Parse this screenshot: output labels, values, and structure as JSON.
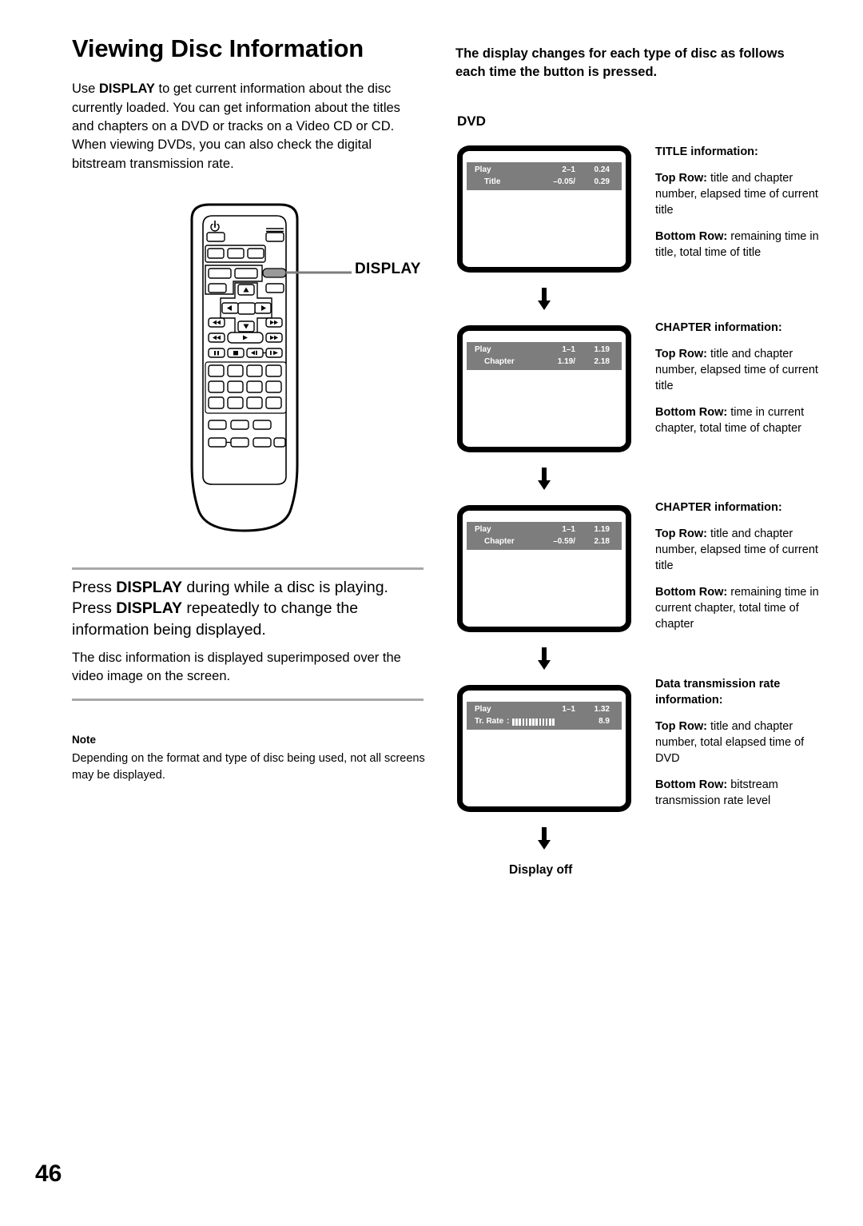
{
  "page": {
    "number": "46"
  },
  "left": {
    "title": "Viewing Disc Information",
    "intro_pre": "Use ",
    "intro_bold": "DISPLAY",
    "intro_post": " to get current information about the disc currently loaded. You can get information about the titles and chapters on a DVD or tracks on a Video CD or CD. When viewing DVDs, you can also check the digital bitstream transmission rate.",
    "remote_callout": "DISPLAY",
    "instruction": {
      "l1_pre": "Press ",
      "l1_bold": "DISPLAY",
      "l1_post": " during while a disc is playing.",
      "l2_pre": "Press ",
      "l2_bold": "DISPLAY",
      "l2_post": " repeatedly to change the information being displayed."
    },
    "superimposed": "The disc information is displayed superimposed over the video image on the screen.",
    "note_heading": "Note",
    "note_body": "Depending on the format and type of disc being used, not all screens may be displayed."
  },
  "right": {
    "heading": "The display changes for each type of disc as follows each time the button is pressed.",
    "disc_type_label": "DVD",
    "display_off": "Display off",
    "screens": [
      {
        "row1_label": "Play",
        "row1_chapter": "2–1",
        "row1_time": "0.24",
        "row2_label": "Title",
        "row2_chapter": "–0.05/",
        "row2_time": "0.29"
      },
      {
        "row1_label": "Play",
        "row1_chapter": "1–1",
        "row1_time": "1.19",
        "row2_label": "Chapter",
        "row2_chapter": "1.19/",
        "row2_time": "2.18"
      },
      {
        "row1_label": "Play",
        "row1_chapter": "1–1",
        "row1_time": "1.19",
        "row2_label": "Chapter",
        "row2_chapter": "–0.59/",
        "row2_time": "2.18"
      },
      {
        "row1_label": "Play",
        "row1_chapter": "1–1",
        "row1_time": "1.32",
        "row2_label": "Tr. Rate",
        "row2_separator": ":",
        "row2_bars": 13,
        "row2_time": "8.9"
      }
    ],
    "descriptions": [
      {
        "heading": "TITLE information:",
        "top_bold": "Top Row",
        "top_sep": ":",
        "top_text": " title and chapter number, elapsed time of current title",
        "bottom_bold": "Bottom Row",
        "bottom_sep": ":",
        "bottom_text": " remaining time in title, total time of title"
      },
      {
        "heading": "CHAPTER information:",
        "top_bold": "Top Row",
        "top_sep": ":",
        "top_text": " title and chapter number, elapsed time of current title",
        "bottom_bold": "Bottom Row",
        "bottom_sep": ":",
        "bottom_text": " time in current chapter, total time of chapter"
      },
      {
        "heading": "CHAPTER information:",
        "top_bold": "Top Row",
        "top_sep": ":",
        "top_text": " title and chapter number, elapsed time of current title",
        "bottom_bold": "Bottom Row",
        "bottom_sep": ":",
        "bottom_text": " remaining time in current chapter, total time of chapter"
      },
      {
        "heading": "Data transmission rate information:",
        "top_bold": "Top Row",
        "top_sep": ":",
        "top_text": " title and chapter number, total elapsed time of DVD",
        "bottom_bold": "Bottom Row",
        "bottom_sep": ":",
        "bottom_text": " bitstream transmission rate level"
      }
    ]
  }
}
